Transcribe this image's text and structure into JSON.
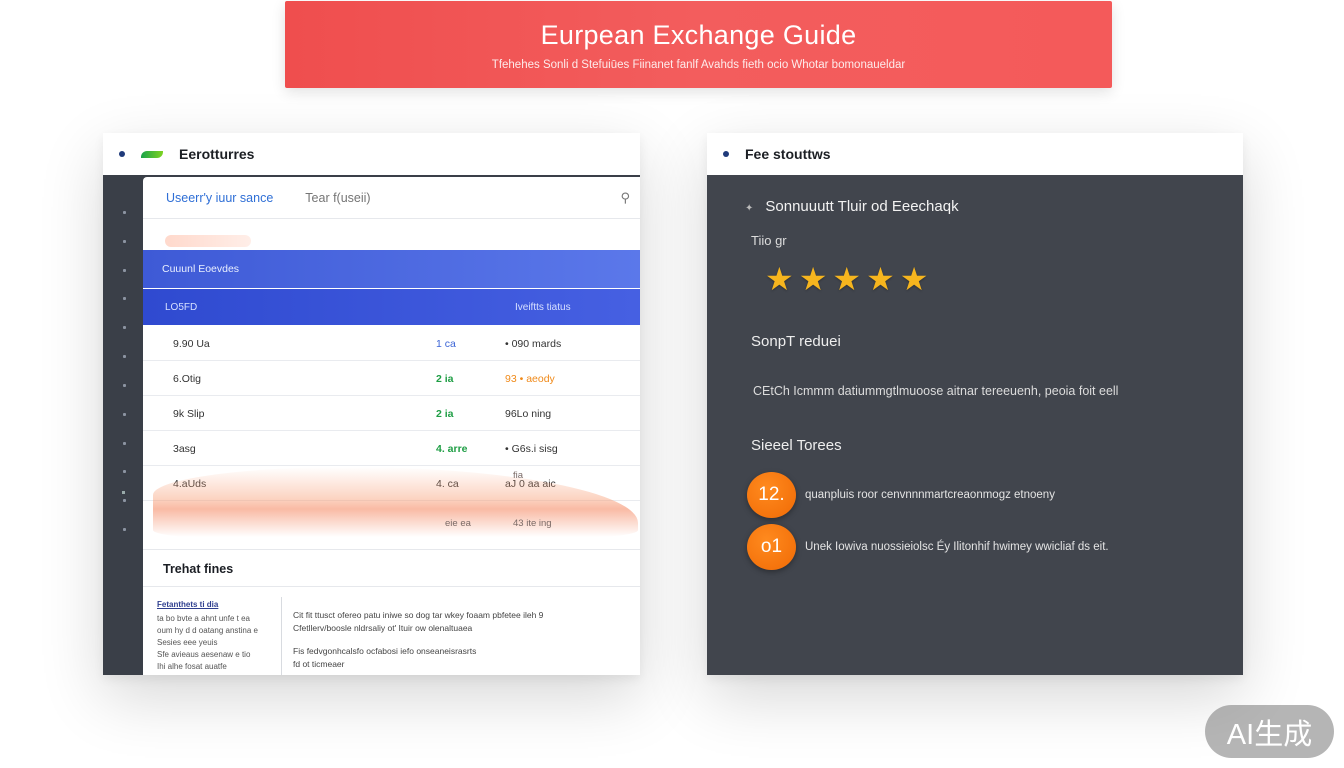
{
  "banner": {
    "title": "Eurpean Exchange Guide",
    "subtitle": "Tfehehes  Sonli d Stefuiūes Fiinanet fanlf Avahds fieth  ocio Whotar bomonaueldar"
  },
  "left_panel": {
    "title": "Eerotturres",
    "search": {
      "label": "Useerr'y iuur sance",
      "placeholder": "Tear f(useii)"
    },
    "table": {
      "banner_label": "Cuuunl  Eoevdes",
      "header_left": "LO5FD",
      "header_right": "Iveiftts tiatus",
      "rows": [
        {
          "c1": "9.90 Ua",
          "c2": "1   ca",
          "c3": "• 090 mards"
        },
        {
          "c1": "6.Otig",
          "c2": "2   ia",
          "c3": "93 • aeody"
        },
        {
          "c1": "9k Slip",
          "c2": "2   ia",
          "c3": "96Lo ning"
        },
        {
          "c1": "3asg",
          "c2": "4. arre",
          "c3": "• G6s.i sisg"
        },
        {
          "c1": "4.aUds",
          "c2": "4.  ca",
          "c3": "aJ 0 aa aic"
        }
      ],
      "overlay": [
        "fia",
        "eie ea",
        "43 ite ing"
      ]
    },
    "trend": {
      "title": "Trehat fines",
      "left_head": "Fetanthets ti dia",
      "left_lines": [
        "ta bo bvte a ahnt unfe t ea",
        "oum hy d d oatang anstina e",
        "Sesies eee yeuis",
        "Sfe avieaus aesenaw e tio",
        "Ihi alhe fosat auatfe"
      ],
      "right_lines": [
        "Cit fit ttusct ofereo patu iniwe so dog tar wkey foaam pbfetee ileh 9",
        "Cfetllerv/boosle nldrsaliy ot' Ituir ow olenaltuaea",
        "Fis fedvgonhcalsfo ocfabosi iefo onseaneisrasrts",
        "fd ot ticmeaer"
      ]
    }
  },
  "right_panel": {
    "title": "Fee stouttws",
    "section_title": "Sonnuuutt Tluir od Eeechaqk",
    "rating_label": "Tiio gr",
    "rating": 5,
    "rating_max": 5,
    "star_color": "#f6b51e",
    "section2": "SonpT reduei",
    "text": "CEtCh Icmmm datiummgtlmuoose aitnar tereeuenh, peoia foit eell",
    "section3": "Sieeel  Torees",
    "tips": [
      {
        "badge": "12.",
        "text": "quanpluis roor cenvnnnmartcreaonmogz etnoeny"
      },
      {
        "badge": "o1",
        "text": "Unek Iowiva nuossieiolsc Éy Ilitonhif hwimey wwicliaf ds eit."
      }
    ]
  },
  "watermark": "AI生成"
}
